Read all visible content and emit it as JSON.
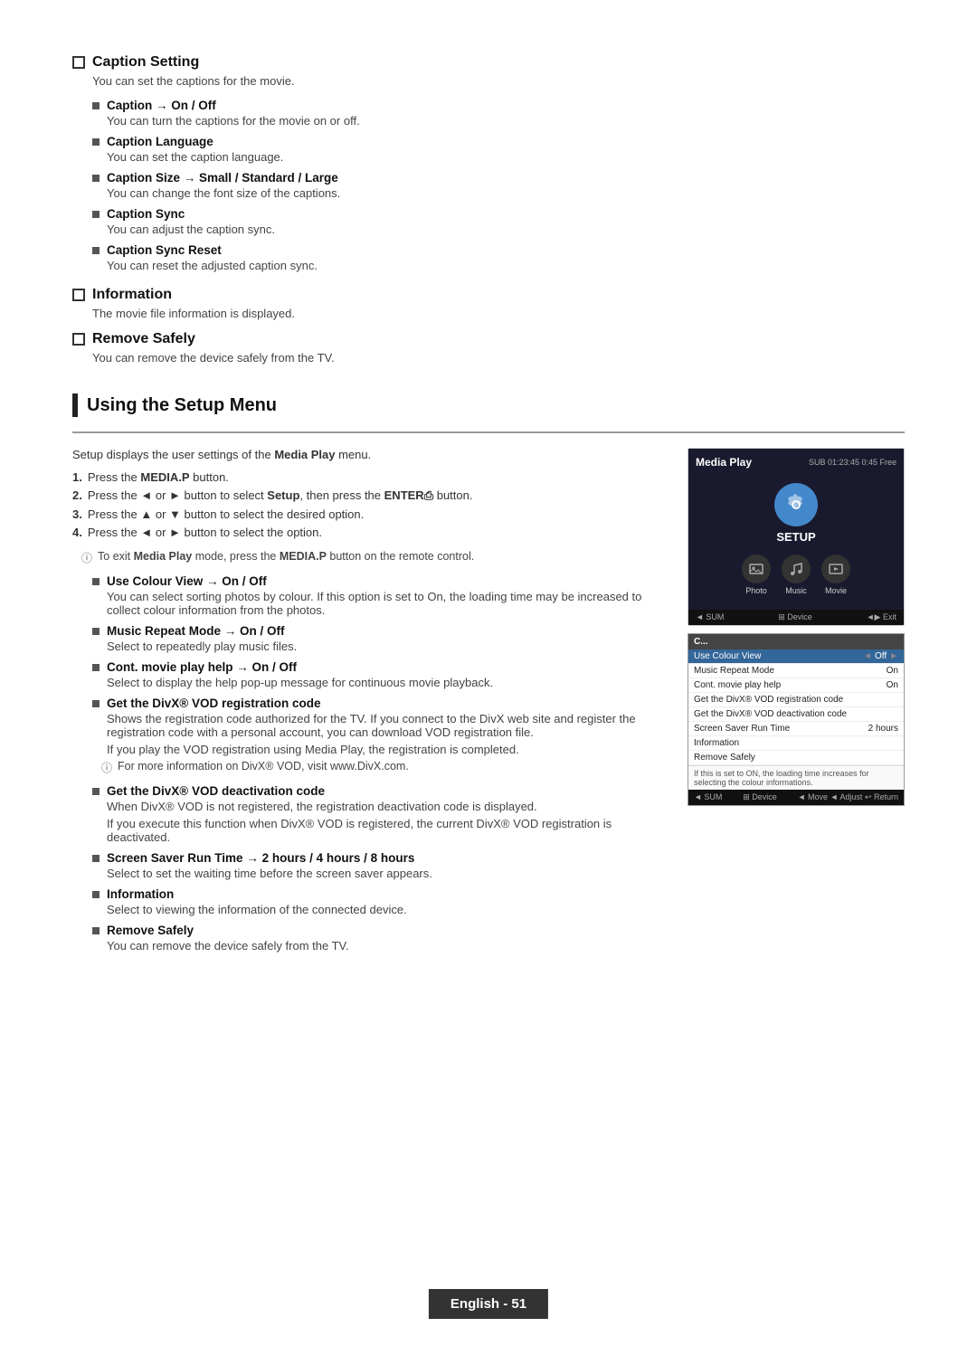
{
  "caption_setting": {
    "heading": "Caption Setting",
    "desc": "You can set the captions for the movie.",
    "items": [
      {
        "title": "Caption → On / Off",
        "desc": "You can turn the captions for the movie on or off."
      },
      {
        "title": "Caption Language",
        "desc": "You can set the caption language."
      },
      {
        "title": "Caption Size → Small / Standard / Large",
        "desc": "You can change the font size of the captions."
      },
      {
        "title": "Caption Sync",
        "desc": "You can adjust the caption sync."
      },
      {
        "title": "Caption Sync Reset",
        "desc": "You can reset the adjusted caption sync."
      }
    ]
  },
  "information": {
    "heading": "Information",
    "desc": "The movie file information is displayed."
  },
  "remove_safely": {
    "heading": "Remove Safely",
    "desc": "You can remove the device safely from the TV."
  },
  "using_setup": {
    "heading": "Using the Setup Menu",
    "intro": "Setup displays the user settings of the",
    "intro_bold": "Media Play",
    "intro_end": "menu.",
    "steps": [
      {
        "num": "1.",
        "text": "Press the ",
        "bold": "MEDIA.P",
        "end": " button."
      },
      {
        "num": "2.",
        "text": "Press the ◄ or ► button to select ",
        "bold": "Setup",
        "middle": ", then press the ",
        "bold2": "ENTER",
        "end": " button."
      },
      {
        "num": "3.",
        "text": "Press the ▲ or ▼ button to select the desired option."
      },
      {
        "num": "4.",
        "text": "Press the ◄ or ► button to select the option."
      }
    ],
    "note": "To exit Media Play mode, press the MEDIA.P button on the remote control.",
    "sub_items": [
      {
        "title": "Use Colour View → On / Off",
        "desc": "You can select sorting photos by colour. If this option is set to On, the loading time may be increased to collect colour information from the photos."
      },
      {
        "title": "Music Repeat Mode → On / Off",
        "desc": "Select to repeatedly play music files."
      },
      {
        "title": "Cont. movie play help → On / Off",
        "desc": "Select to display the help pop-up message for continuous movie playback."
      },
      {
        "title": "Get the DivX® VOD registration code",
        "desc": "Shows the registration code authorized for the TV. If you connect to the DivX web site and register the registration code with a personal account, you can download VOD registration file.",
        "extra": "If you play the VOD registration using Media Play, the registration is completed.",
        "note": "For more information on DivX® VOD, visit www.DivX.com."
      },
      {
        "title": "Get the DivX® VOD deactivation code",
        "desc": "When DivX® VOD is not registered, the registration deactivation code is displayed.",
        "extra": "If you execute this function when DivX® VOD is registered, the current DivX® VOD registration is deactivated."
      },
      {
        "title": "Screen Saver Run Time → 2 hours / 4 hours / 8 hours",
        "desc": "Select to set the waiting time before the screen saver appears."
      },
      {
        "title": "Information",
        "desc": "Select to viewing the information of the connected device."
      },
      {
        "title": "Remove Safely",
        "desc": "You can remove the device safely from the TV."
      }
    ]
  },
  "screenshot1": {
    "title": "Media Play",
    "info": "SUB 01:23:45 0:45 Free",
    "icons": [
      {
        "label": "Photo",
        "active": false
      },
      {
        "label": "Music",
        "active": false
      },
      {
        "label": "Movie",
        "active": false
      },
      {
        "label": "Setup",
        "active": true
      }
    ],
    "setup_label": "SETUP",
    "bottom": [
      "◄ SUM",
      "⊞ Device",
      "◄▶ Exit"
    ]
  },
  "screenshot2": {
    "header": "C...",
    "rows": [
      {
        "label": "Use Colour View",
        "arrow_left": "◄",
        "value": "Off",
        "arrow_right": "►",
        "highlighted": true
      },
      {
        "label": "Music Repeat Mode",
        "value": "On",
        "highlighted": false
      },
      {
        "label": "Cont. movie play help",
        "value": "On",
        "highlighted": false
      },
      {
        "label": "Get the DivX® VOD registration code",
        "value": "",
        "highlighted": false
      },
      {
        "label": "Get the DivX® VOD deactivation code",
        "value": "",
        "highlighted": false
      },
      {
        "label": "Screen Saver Run Time",
        "value": "2 hours",
        "highlighted": false
      },
      {
        "label": "Information",
        "value": "",
        "highlighted": false
      },
      {
        "label": "Remove Safely",
        "value": "",
        "highlighted": false
      }
    ],
    "note": "If this is set to ON, the loading time increases for selecting the colour informations.",
    "bottom": [
      "◄ SUM",
      "⊞ Device",
      "◄ Move  ◄ Adjust  ↩ Return"
    ]
  },
  "footer": {
    "text": "English - 51"
  }
}
